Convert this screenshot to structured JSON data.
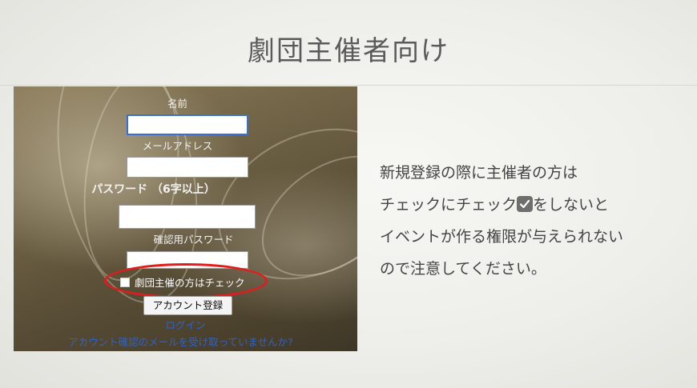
{
  "slide": {
    "title": "劇団主催者向け"
  },
  "form": {
    "name_label": "名前",
    "email_label": "メールアドレス",
    "password_label": "パスワード （6字以上）",
    "confirm_password_label": "確認用パスワード",
    "organizer_checkbox_label": "劇団主催の方はチェック",
    "submit_label": "アカウント登録",
    "login_link": "ログイン",
    "confirmation_link": "アカウント確認のメールを受け取っていませんか?"
  },
  "description": {
    "line1": "新規登録の際に主催者の方は",
    "line2_before": "チェックにチェック",
    "line2_after": "をしないと",
    "line3": "イベントが作る権限が与えられない",
    "line4": "ので注意してください。",
    "icon": "checkbox-checked-icon"
  },
  "colors": {
    "annotation": "#e21b1b",
    "link": "#2d63c8",
    "focus": "#3a6fd8"
  }
}
